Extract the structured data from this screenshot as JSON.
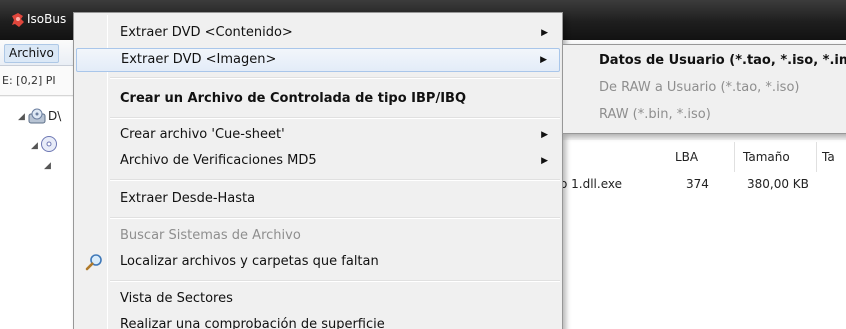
{
  "window": {
    "title": "IsoBus",
    "menubar": {
      "first_menu": "Archivo"
    },
    "address": "E: [0,2] PI"
  },
  "tree": {
    "items": [
      {
        "label": "D\\",
        "icon": "dvd-drive-icon"
      },
      {
        "label": "",
        "icon": "disc-icon"
      }
    ]
  },
  "file_list": {
    "headers": {
      "lba": "LBA",
      "size": "Tamaño",
      "extra": "Ta"
    },
    "rows": [
      {
        "name": "o 1.dll.exe",
        "lba": "374",
        "size": "380,00 KB"
      }
    ]
  },
  "context_menu": {
    "items": [
      {
        "label": "Extraer DVD  <Contenido>",
        "has_submenu": true
      },
      {
        "label": "Extraer DVD  <Imagen>",
        "has_submenu": true,
        "highlighted": true
      },
      {
        "label": "Crear un Archivo de Controlada de tipo IBP/IBQ",
        "bold": true
      },
      {
        "label": "Crear archivo 'Cue-sheet'",
        "has_submenu": true
      },
      {
        "label": "Archivo de Verificaciones MD5",
        "has_submenu": true
      },
      {
        "label": "Extraer Desde-Hasta"
      },
      {
        "label": "Buscar Sistemas de Archivo",
        "disabled": true
      },
      {
        "label": "Localizar archivos y carpetas que faltan",
        "icon": "magnifier-icon"
      },
      {
        "label": "Vista de Sectores"
      },
      {
        "label": "Realizar una comprobación de superficie"
      }
    ]
  },
  "submenu": {
    "items": [
      {
        "label": "Datos de Usuario (*.tao, *.iso, *.img)",
        "bold": true
      },
      {
        "label": "De RAW a Usuario (*.tao, *.iso)",
        "disabled": true
      },
      {
        "label": "RAW (*.bin, *.iso)",
        "disabled": true
      }
    ]
  },
  "colors": {
    "menu_bg": "#f0f0f0",
    "highlight_border": "#a9c6ea",
    "disabled_text": "#8e8e8e",
    "titlebar": "#1e1e1e"
  }
}
